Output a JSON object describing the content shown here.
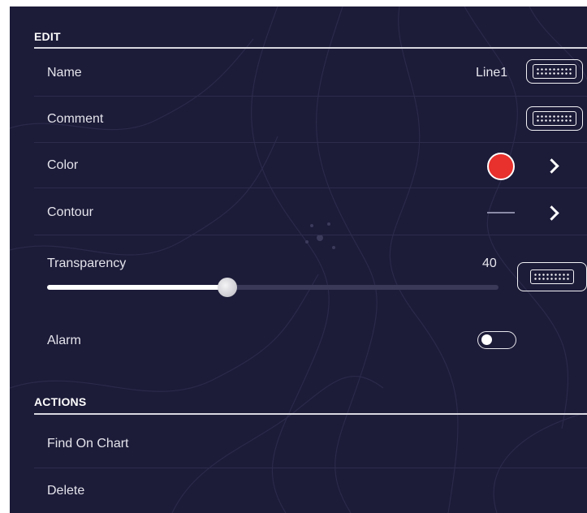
{
  "edit": {
    "heading": "EDIT",
    "name": {
      "label": "Name",
      "value": "Line1",
      "keyboard_icon": "keyboard-icon"
    },
    "comment": {
      "label": "Comment",
      "keyboard_icon": "keyboard-icon"
    },
    "color": {
      "label": "Color",
      "swatch": "#e8302c",
      "chevron_icon": "chevron-right-icon"
    },
    "contour": {
      "label": "Contour",
      "chevron_icon": "chevron-right-icon"
    },
    "transparency": {
      "label": "Transparency",
      "value": "40",
      "level_percent": 40,
      "keyboard_icon": "keyboard-icon"
    },
    "alarm": {
      "label": "Alarm",
      "on": false
    }
  },
  "actions": {
    "heading": "ACTIONS",
    "items": [
      {
        "label": "Find On Chart"
      },
      {
        "label": "Delete"
      }
    ]
  },
  "theme": {
    "background": "#1c1b38",
    "accent": "#ffffff",
    "swatch_border": "#ffffff"
  }
}
